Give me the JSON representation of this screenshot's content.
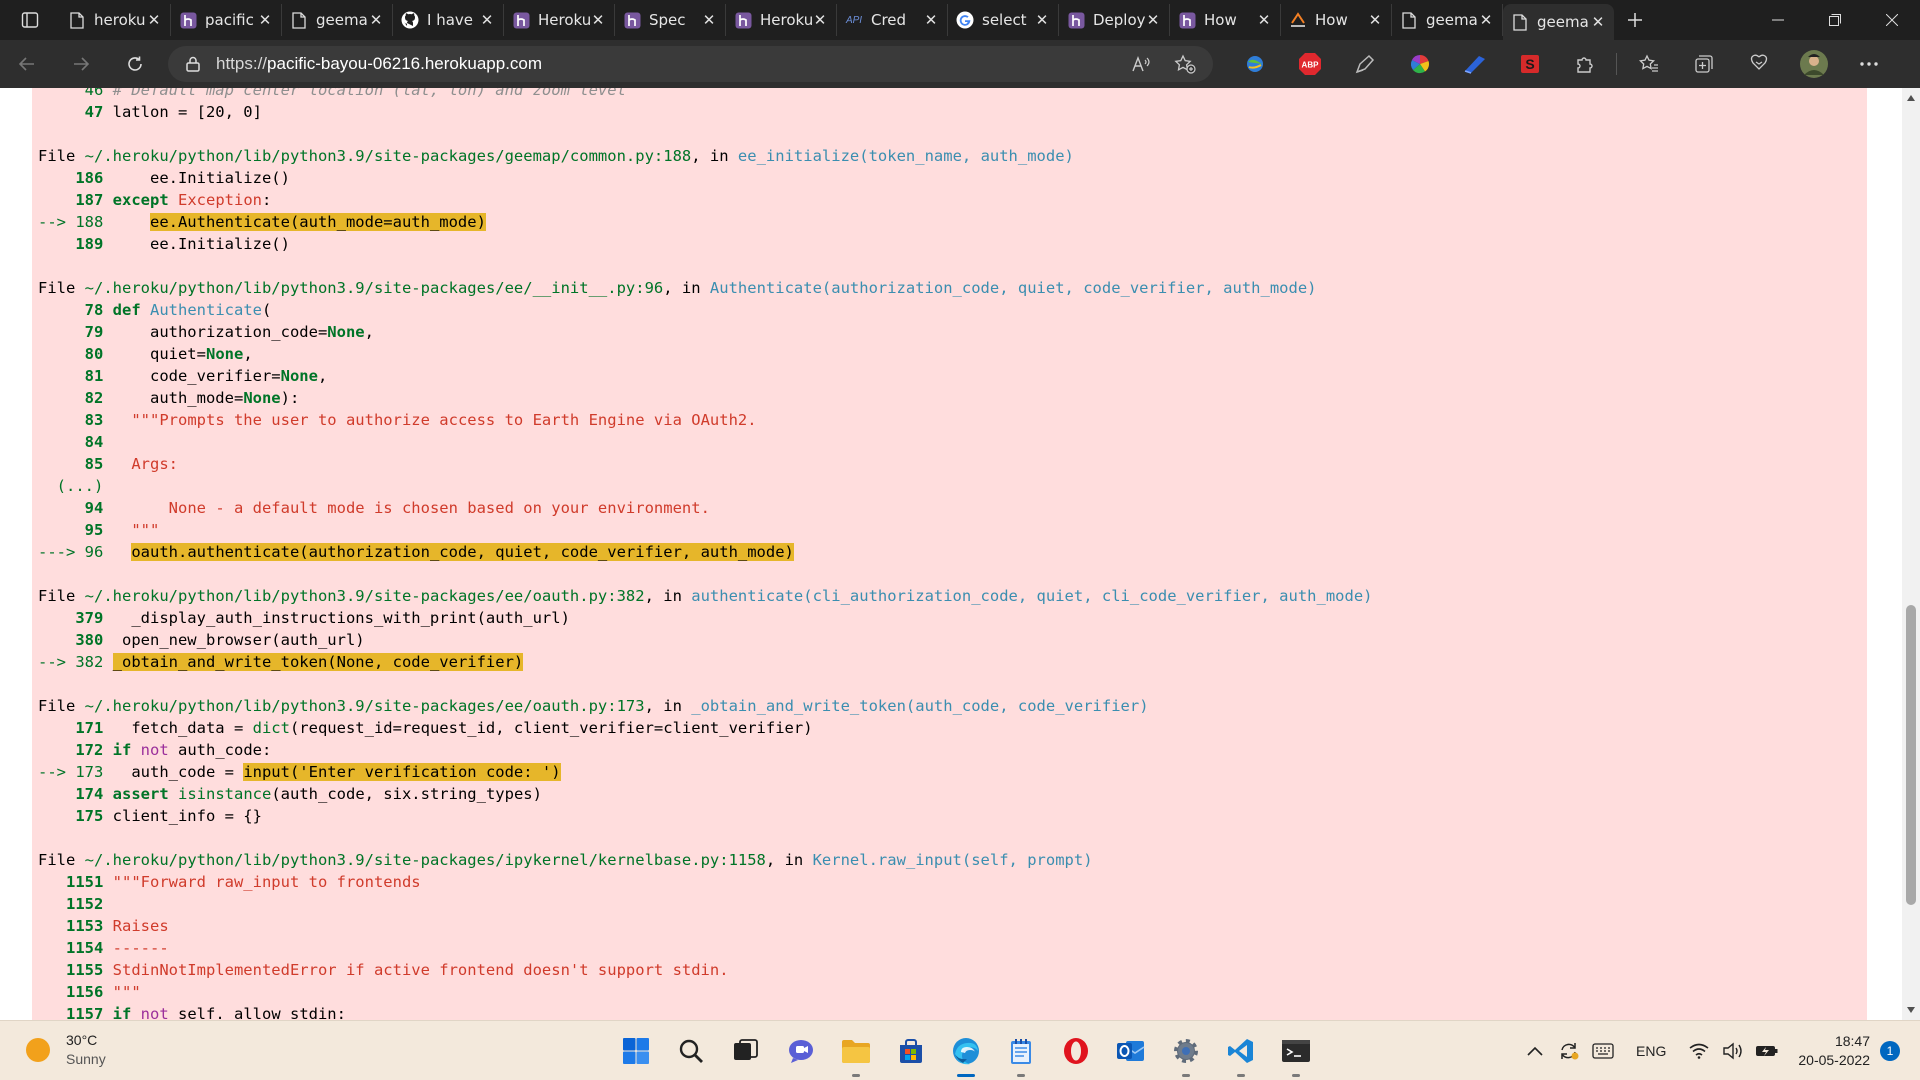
{
  "browser": {
    "tabs": [
      {
        "title": "heroku",
        "icon": "document-icon"
      },
      {
        "title": "pacific",
        "icon": "heroku-icon"
      },
      {
        "title": "geemap",
        "icon": "document-icon"
      },
      {
        "title": "I have",
        "icon": "github-icon"
      },
      {
        "title": "Heroku",
        "icon": "heroku-icon"
      },
      {
        "title": "Spec",
        "icon": "heroku-icon"
      },
      {
        "title": "Heroku",
        "icon": "heroku-icon"
      },
      {
        "title": "Cred",
        "icon": "api-icon"
      },
      {
        "title": "select",
        "icon": "google-icon"
      },
      {
        "title": "Deploy",
        "icon": "heroku-icon"
      },
      {
        "title": "How",
        "icon": "heroku-icon"
      },
      {
        "title": "How",
        "icon": "stack-icon"
      },
      {
        "title": "geemap",
        "icon": "document-icon"
      },
      {
        "title": "geemap",
        "icon": "document-icon"
      }
    ],
    "active_tab": 13,
    "api_badge": "API",
    "url_prefix": "https://",
    "url_host": "pacific-bayou-06216.herokuapp.com",
    "ext_abp": "ABP",
    "ext_s": "S"
  },
  "traceback": {
    "lines": [
      {
        "segs": [
          {
            "t": "     46 ",
            "c": "g"
          },
          {
            "t": "# Default map center location (lat, lon) and zoom level",
            "c": "it"
          }
        ]
      },
      {
        "segs": [
          {
            "t": "     47 ",
            "c": "gb"
          },
          {
            "t": "latlon = [20, 0]"
          }
        ]
      },
      {
        "segs": []
      },
      {
        "segs": [
          {
            "t": "File "
          },
          {
            "t": "~/.heroku/python/lib/python3.9/site-packages/geemap/common.py:188",
            "c": "g"
          },
          {
            "t": ", in "
          },
          {
            "t": "ee_initialize",
            "c": "c"
          },
          {
            "t": "(token_name, auth_mode)",
            "c": "fn"
          }
        ]
      },
      {
        "segs": [
          {
            "t": "    186 ",
            "c": "gb"
          },
          {
            "t": "    ee.Initialize()"
          }
        ]
      },
      {
        "segs": [
          {
            "t": "    187 ",
            "c": "gb"
          },
          {
            "t": "except",
            "c": "k"
          },
          {
            "t": " "
          },
          {
            "t": "Exception",
            "c": "r"
          },
          {
            "t": ":"
          }
        ]
      },
      {
        "segs": [
          {
            "t": "--> 188 ",
            "c": "g"
          },
          {
            "t": "    "
          },
          {
            "t": "ee.Authenticate(auth_mode=auth_mode)",
            "c": "hl"
          }
        ]
      },
      {
        "segs": [
          {
            "t": "    189 ",
            "c": "gb"
          },
          {
            "t": "    ee.Initialize()"
          }
        ]
      },
      {
        "segs": []
      },
      {
        "segs": [
          {
            "t": "File "
          },
          {
            "t": "~/.heroku/python/lib/python3.9/site-packages/ee/__init__.py:96",
            "c": "g"
          },
          {
            "t": ", in "
          },
          {
            "t": "Authenticate",
            "c": "c"
          },
          {
            "t": "(authorization_code, quiet, code_verifier, auth_mode)",
            "c": "fn"
          }
        ]
      },
      {
        "segs": [
          {
            "t": "     78 ",
            "c": "gb"
          },
          {
            "t": "def",
            "c": "k"
          },
          {
            "t": " "
          },
          {
            "t": "Authenticate",
            "c": "c"
          },
          {
            "t": "("
          }
        ]
      },
      {
        "segs": [
          {
            "t": "     79 ",
            "c": "gb"
          },
          {
            "t": "    authorization_code="
          },
          {
            "t": "None",
            "c": "k"
          },
          {
            "t": ","
          }
        ]
      },
      {
        "segs": [
          {
            "t": "     80 ",
            "c": "gb"
          },
          {
            "t": "    quiet="
          },
          {
            "t": "None",
            "c": "k"
          },
          {
            "t": ","
          }
        ]
      },
      {
        "segs": [
          {
            "t": "     81 ",
            "c": "gb"
          },
          {
            "t": "    code_verifier="
          },
          {
            "t": "None",
            "c": "k"
          },
          {
            "t": ","
          }
        ]
      },
      {
        "segs": [
          {
            "t": "     82 ",
            "c": "gb"
          },
          {
            "t": "    auth_mode="
          },
          {
            "t": "None",
            "c": "k"
          },
          {
            "t": "):"
          }
        ]
      },
      {
        "segs": [
          {
            "t": "     83 ",
            "c": "gb"
          },
          {
            "t": "  "
          },
          {
            "t": "\"\"\"Prompts the user to authorize access to Earth Engine via OAuth2.",
            "c": "r"
          }
        ]
      },
      {
        "segs": [
          {
            "t": "     84 ",
            "c": "gb"
          }
        ]
      },
      {
        "segs": [
          {
            "t": "     85 ",
            "c": "gb"
          },
          {
            "t": "  "
          },
          {
            "t": "Args:",
            "c": "r"
          }
        ]
      },
      {
        "segs": [
          {
            "t": "  (...)",
            "c": "g"
          }
        ]
      },
      {
        "segs": [
          {
            "t": "     94 ",
            "c": "gb"
          },
          {
            "t": "      "
          },
          {
            "t": "None - a default mode is chosen based on your environment.",
            "c": "r"
          }
        ]
      },
      {
        "segs": [
          {
            "t": "     95 ",
            "c": "gb"
          },
          {
            "t": "  "
          },
          {
            "t": "\"\"\"",
            "c": "r"
          }
        ]
      },
      {
        "segs": [
          {
            "t": "---> 96 ",
            "c": "g"
          },
          {
            "t": "  "
          },
          {
            "t": "oauth.authenticate(authorization_code, quiet, code_verifier, auth_mode)",
            "c": "hl"
          }
        ]
      },
      {
        "segs": []
      },
      {
        "segs": [
          {
            "t": "File "
          },
          {
            "t": "~/.heroku/python/lib/python3.9/site-packages/ee/oauth.py:382",
            "c": "g"
          },
          {
            "t": ", in "
          },
          {
            "t": "authenticate",
            "c": "c"
          },
          {
            "t": "(cli_authorization_code, quiet, cli_code_verifier, auth_mode)",
            "c": "fn"
          }
        ]
      },
      {
        "segs": [
          {
            "t": "    379 ",
            "c": "gb"
          },
          {
            "t": "  _display_auth_instructions_with_print(auth_url)"
          }
        ]
      },
      {
        "segs": [
          {
            "t": "    380 ",
            "c": "gb"
          },
          {
            "t": " open_new_browser(auth_url)"
          }
        ]
      },
      {
        "segs": [
          {
            "t": "--> 382 ",
            "c": "g"
          },
          {
            "t": "_obtain_and_write_token(",
            "c": "hl"
          },
          {
            "t": "None",
            "c": "hl"
          },
          {
            "t": ", code_verifier)",
            "c": "hl"
          }
        ]
      },
      {
        "segs": []
      },
      {
        "segs": [
          {
            "t": "File "
          },
          {
            "t": "~/.heroku/python/lib/python3.9/site-packages/ee/oauth.py:173",
            "c": "g"
          },
          {
            "t": ", in "
          },
          {
            "t": "_obtain_and_write_token",
            "c": "c"
          },
          {
            "t": "(auth_code, code_verifier)",
            "c": "fn"
          }
        ]
      },
      {
        "segs": [
          {
            "t": "    171 ",
            "c": "gb"
          },
          {
            "t": "  fetch_data = "
          },
          {
            "t": "dict",
            "c": "g"
          },
          {
            "t": "(request_id=request_id, client_verifier=client_verifier)"
          }
        ]
      },
      {
        "segs": [
          {
            "t": "    172 ",
            "c": "gb"
          },
          {
            "t": "if",
            "c": "k"
          },
          {
            "t": " "
          },
          {
            "t": "not",
            "c": "p"
          },
          {
            "t": " auth_code:"
          }
        ]
      },
      {
        "segs": [
          {
            "t": "--> 173 ",
            "c": "g"
          },
          {
            "t": "  auth_code = "
          },
          {
            "t": "input('Enter verification code: ')",
            "c": "hl"
          }
        ]
      },
      {
        "segs": [
          {
            "t": "    174 ",
            "c": "gb"
          },
          {
            "t": "assert",
            "c": "k"
          },
          {
            "t": " "
          },
          {
            "t": "isinstance",
            "c": "g"
          },
          {
            "t": "(auth_code, six.string_types)"
          }
        ]
      },
      {
        "segs": [
          {
            "t": "    175 ",
            "c": "gb"
          },
          {
            "t": "client_info = {}"
          }
        ]
      },
      {
        "segs": []
      },
      {
        "segs": [
          {
            "t": "File "
          },
          {
            "t": "~/.heroku/python/lib/python3.9/site-packages/ipykernel/kernelbase.py:1158",
            "c": "g"
          },
          {
            "t": ", in "
          },
          {
            "t": "Kernel.raw_input",
            "c": "c"
          },
          {
            "t": "(self, prompt)",
            "c": "fn"
          }
        ]
      },
      {
        "segs": [
          {
            "t": "   1151 ",
            "c": "gb"
          },
          {
            "t": "\"\"\"Forward raw_input to frontends",
            "c": "r"
          }
        ]
      },
      {
        "segs": [
          {
            "t": "   1152 ",
            "c": "gb"
          }
        ]
      },
      {
        "segs": [
          {
            "t": "   1153 ",
            "c": "gb"
          },
          {
            "t": "Raises",
            "c": "r"
          }
        ]
      },
      {
        "segs": [
          {
            "t": "   1154 ",
            "c": "gb"
          },
          {
            "t": "------",
            "c": "r"
          }
        ]
      },
      {
        "segs": [
          {
            "t": "   1155 ",
            "c": "gb"
          },
          {
            "t": "StdinNotImplementedError if active frontend doesn't support stdin.",
            "c": "r"
          }
        ]
      },
      {
        "segs": [
          {
            "t": "   1156 ",
            "c": "gb"
          },
          {
            "t": "\"\"\"",
            "c": "r"
          }
        ]
      },
      {
        "segs": [
          {
            "t": "   1157 ",
            "c": "gb"
          },
          {
            "t": "if",
            "c": "k"
          },
          {
            "t": " "
          },
          {
            "t": "not",
            "c": "p"
          },
          {
            "t": " self._allow_stdin:"
          }
        ]
      }
    ]
  },
  "taskbar": {
    "temperature": "30°C",
    "condition": "Sunny",
    "lang": "ENG",
    "time": "18:47",
    "date": "20-05-2022",
    "notifications": "1"
  },
  "colors": {
    "traceback_bg": "#ffdddd",
    "highlight": "#e6b62a",
    "green": "#007427",
    "cyan": "#3b8eb0",
    "red": "#d03b2b"
  }
}
